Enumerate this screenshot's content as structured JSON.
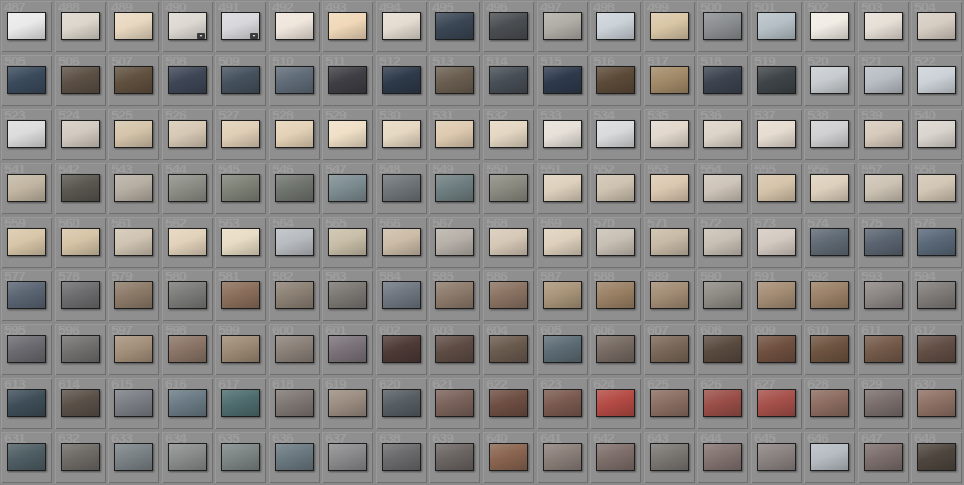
{
  "grid": {
    "columns": 18,
    "rows": 9,
    "first_number": 487
  },
  "rows": [
    {
      "start": 487,
      "colors": [
        "#eaeaea",
        "#dcd6cc",
        "#e8d8c0",
        "#ddd8d2",
        "#d8d8dc",
        "#efe6dc",
        "#f0d8b8",
        "#e4dcd0",
        "#3a4654",
        "#4a4e52",
        "#b0aca6",
        "#cbd2d8",
        "#d9c6a6",
        "#8b8e90",
        "#b5c0c6",
        "#f1ece4",
        "#e6dfd6",
        "#d6cdc2",
        "#5a4240",
        "#5e3a36"
      ]
    },
    {
      "start": 505,
      "colors": [
        "#3a4a5c",
        "#5c5044",
        "#60503e",
        "#3e4656",
        "#45515e",
        "#5f6b77",
        "#3e3e44",
        "#2e3a4a",
        "#6a5e50",
        "#484e56",
        "#2e3a4c",
        "#5c4a38",
        "#a28a68",
        "#3c4450",
        "#3e4448",
        "#c8ccd0",
        "#b8bec4",
        "#ccd2d8",
        "#c6ccd4",
        "#cfd4d8"
      ]
    },
    {
      "start": 523,
      "colors": [
        "#dcdcdc",
        "#d2cac0",
        "#d4c4aa",
        "#d6c8b4",
        "#e0cfb6",
        "#e4d2b6",
        "#efdfc6",
        "#e6d8c2",
        "#decab0",
        "#e4d6c2",
        "#e6e0d8",
        "#d8dadc",
        "#e2d8cc",
        "#ddd4c8",
        "#e6dcd0",
        "#d0d0d2",
        "#d6cabc",
        "#dad4ce"
      ]
    },
    {
      "start": 541,
      "colors": [
        "#c2b6a2",
        "#5a5650",
        "#b6aea2",
        "#8c8e86",
        "#7e8276",
        "#70746e",
        "#7c8c90",
        "#6e7478",
        "#6e7e80",
        "#8a8a80",
        "#ded0bc",
        "#cec2b0",
        "#dcc8b0",
        "#cec4b8",
        "#d6c4aa",
        "#ded0bc",
        "#cdc3b4",
        "#d2c6b4"
      ]
    },
    {
      "start": 559,
      "colors": [
        "#d8c6a8",
        "#d6c4a6",
        "#d0c4b2",
        "#e2d2ba",
        "#e8dcc4",
        "#b8bcc0",
        "#c8bea8",
        "#ccbca8",
        "#b6b0a8",
        "#d6c8b6",
        "#ded0bc",
        "#c8c0b4",
        "#c8baa6",
        "#c8c0b4",
        "#d4cac2",
        "#606a74",
        "#5a6470",
        "#5a6878"
      ]
    },
    {
      "start": 577,
      "colors": [
        "#5a6472",
        "#6c6c6e",
        "#8c7a68",
        "#7a7a78",
        "#8a6e5a",
        "#8c8074",
        "#7a7672",
        "#6e7680",
        "#8c7a6a",
        "#8a7262",
        "#a89478",
        "#9a8064",
        "#a28c74",
        "#8e8a84",
        "#a48c74",
        "#9a8066",
        "#8c8684",
        "#7e7a78"
      ]
    },
    {
      "start": 595,
      "colors": [
        "#6a6a70",
        "#72706e",
        "#a4907a",
        "#8a7466",
        "#9c8a74",
        "#8a8078",
        "#7a7278",
        "#4e3a36",
        "#5e4c44",
        "#6a5a4e",
        "#5c6c74",
        "#766a62",
        "#7a6858",
        "#5a4a3e",
        "#705040",
        "#6e5440",
        "#745a4a",
        "#624e44"
      ]
    },
    {
      "start": 613,
      "colors": [
        "#3e4e58",
        "#5a5048",
        "#7a7e84",
        "#6a7a84",
        "#4e6c6e",
        "#7e7672",
        "#9a8c80",
        "#565e64",
        "#7a625a",
        "#6e4e42",
        "#7a5a50",
        "#b44a44",
        "#8a6e62",
        "#9a4e48",
        "#a6504a",
        "#8c6c60",
        "#7a6e6c",
        "#8e7064"
      ]
    },
    {
      "start": 631,
      "colors": [
        "#4e5e64",
        "#6e6a66",
        "#7a8286",
        "#8a8c8c",
        "#7c8484",
        "#6a7880",
        "#8a8a8c",
        "#6a6a6c",
        "#6a6462",
        "#8a6450",
        "#8a7e78",
        "#7e6e6a",
        "#7a7672",
        "#827270",
        "#8a8280",
        "#b6bcc2",
        "#7c6e6c",
        "#4e463e"
      ]
    }
  ],
  "badge_cells": [
    490,
    491
  ],
  "badge_icon": "menu-badge-icon"
}
